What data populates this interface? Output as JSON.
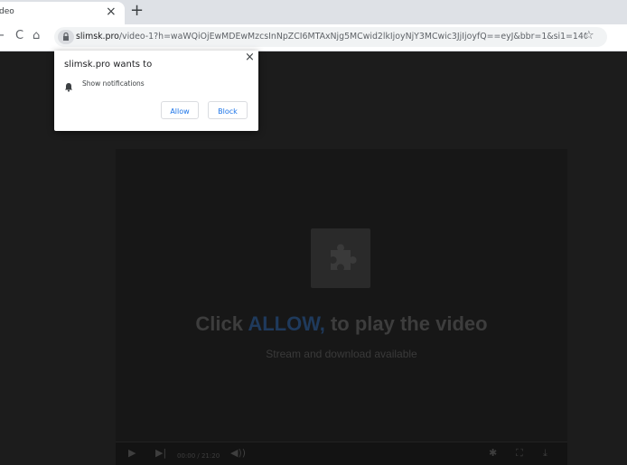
{
  "browser": {
    "tab": {
      "title": "deo",
      "close": "×"
    },
    "new_tab": "+",
    "nav": {
      "back": "←",
      "reload": "C",
      "home": "⌂"
    },
    "address": {
      "host": "slimsk.pro",
      "path": "/video-1?h=waWQiOjEwMDEwMzcsInNpZCI6MTAxNjg5MCwid2lkIjoyNjY3MCwic3JjIjoyfQ==eyJ&bbr=1&si1=140...",
      "star": "☆"
    }
  },
  "notification_prompt": {
    "title": "slimsk.pro wants to",
    "permission": "Show notifications",
    "close": "×",
    "allow_label": "Allow",
    "block_label": "Block"
  },
  "player": {
    "headline_prefix": "Click ",
    "headline_allow": "ALLOW,",
    "headline_suffix": " to play the video",
    "subline": "Stream and download available",
    "controls": {
      "play": "▶",
      "next": "▶|",
      "time": "00:00 / 21:20",
      "volume": "◀))",
      "settings": "✱",
      "fullscreen": "⛶",
      "download": "⤓"
    }
  },
  "colors": {
    "page_bg": "#1c1c1c",
    "allow_highlight": "#1f3a5c",
    "button_text": "#1a73e8"
  }
}
